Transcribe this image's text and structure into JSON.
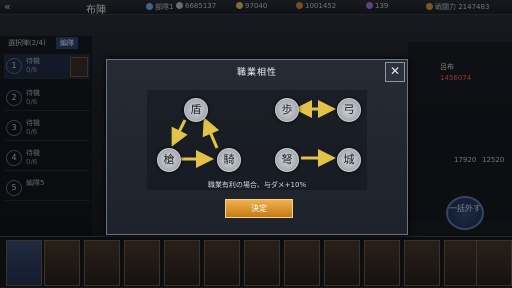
{
  "topbar": {
    "back_icon": "double-chevron-left",
    "title": "布陣",
    "resources": [
      {
        "icon": "rank-icon",
        "value": "部隊1",
        "color": "#7fb0ff"
      },
      {
        "icon": "silver-icon",
        "value": "6685137",
        "color": "#c0c6d0"
      },
      {
        "icon": "grain-icon",
        "value": "97040",
        "color": "#e6c56a"
      },
      {
        "icon": "coin-icon",
        "value": "1001452",
        "color": "#e08a3a"
      },
      {
        "icon": "gem-icon",
        "value": "139",
        "color": "#b47be0"
      },
      {
        "icon": "power-icon",
        "value": "戦闘力 2147483",
        "color": "#d9a13b"
      }
    ]
  },
  "left_panel": {
    "tabs": [
      "選択陣(2/4)",
      "編隊"
    ],
    "slots": [
      {
        "num": "1",
        "line1": "待機",
        "line2": "0/6"
      },
      {
        "num": "2",
        "line1": "待機",
        "line2": "0/6"
      },
      {
        "num": "3",
        "line1": "待機",
        "line2": "0/6"
      },
      {
        "num": "4",
        "line1": "待機",
        "line2": "0/6"
      },
      {
        "num": "5",
        "line1": "編隊5",
        "line2": ""
      }
    ]
  },
  "right_panel": {
    "name": "呂布",
    "power": "1456074",
    "counter": "17920",
    "counter2": "12520",
    "remove_button": "一括外す"
  },
  "modal": {
    "title": "職業相性",
    "close_icon": "close-icon",
    "description": "職業有利の場合、与ダメ+10%",
    "confirm_label": "決定",
    "class_icons": {
      "shield": "盾",
      "cavalry": "騎",
      "spear": "槍",
      "infantry": "歩",
      "archer": "弓",
      "siege": "城",
      "crossbow": "弩"
    }
  },
  "colors": {
    "accent_gold": "#e0a23a",
    "arrow_yellow": "#e3c24a",
    "panel_border": "#6b7280"
  }
}
